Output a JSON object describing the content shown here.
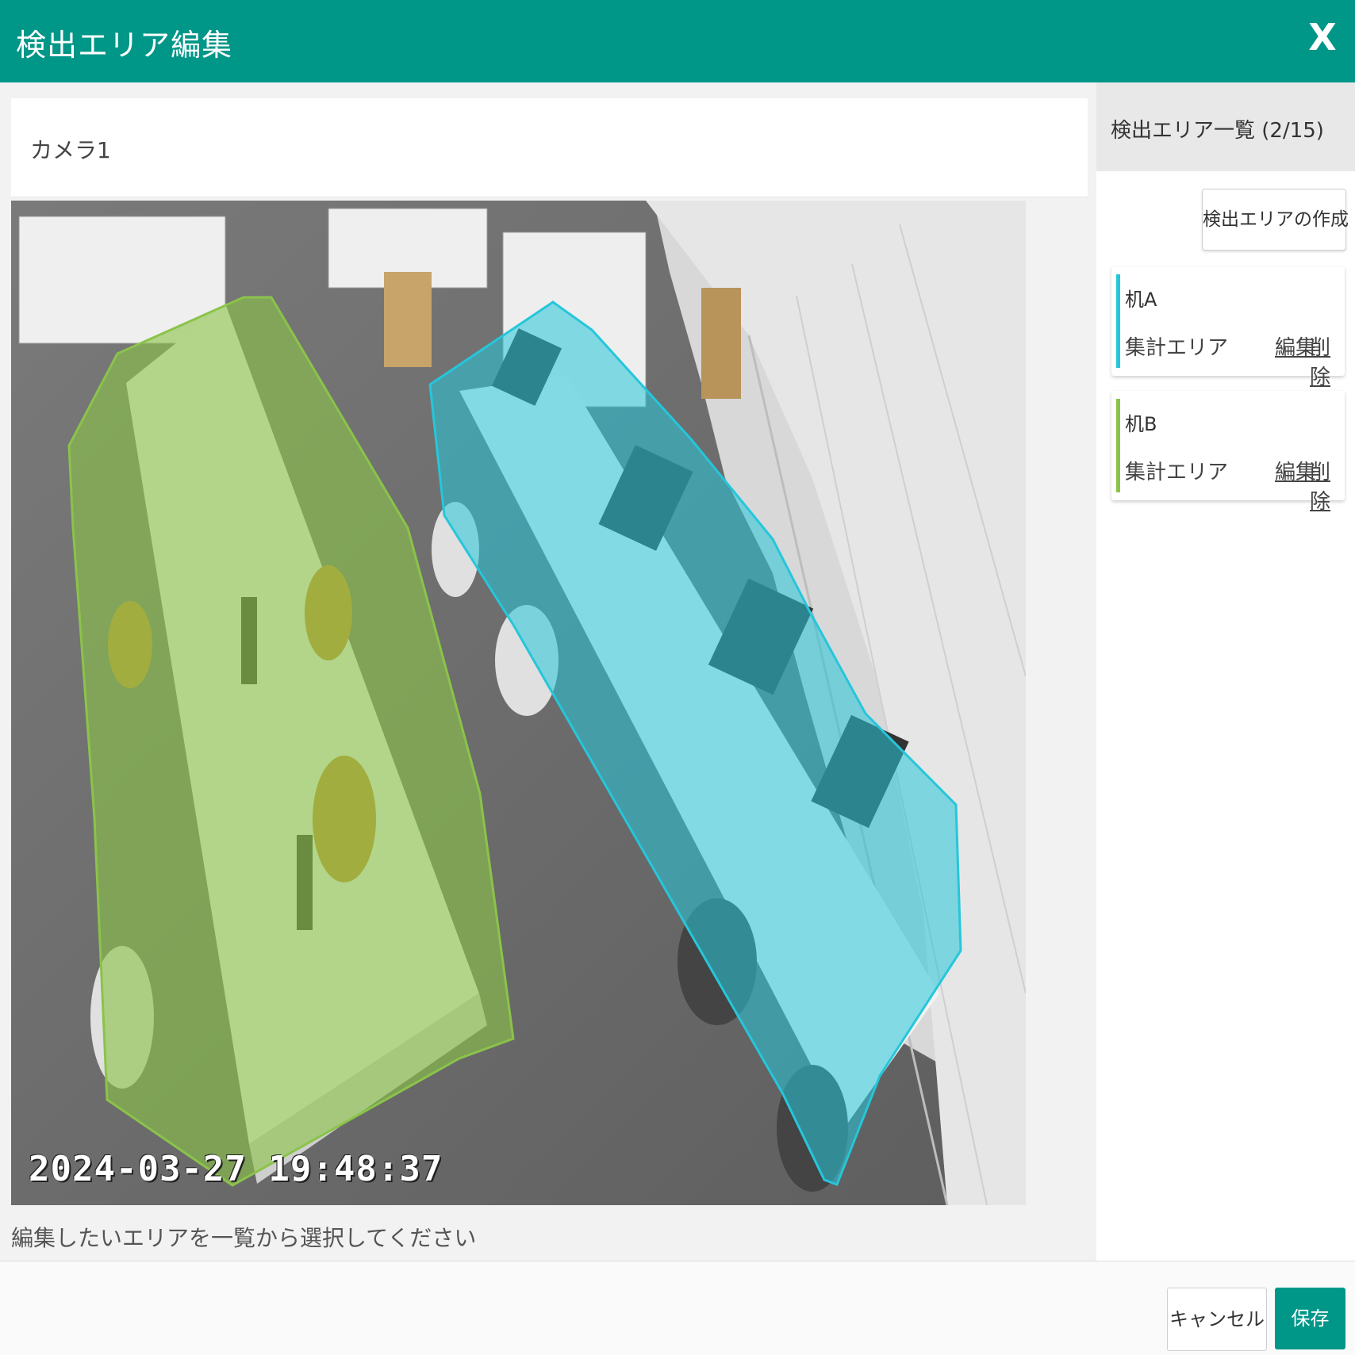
{
  "dialog": {
    "title": "検出エリア編集",
    "close_label": "X"
  },
  "camera": {
    "name": "カメラ1",
    "timestamp": "2024-03-27 19:48:37",
    "hint": "編集したいエリアを一覧から選択してください"
  },
  "sidebar": {
    "header": "検出エリア一覧 (2/15)",
    "create_label": "検出エリアの作成",
    "areas": [
      {
        "name": "机A",
        "type": "集計エリア",
        "edit_label": "編集",
        "delete_label": "削除",
        "color": "#26c6da"
      },
      {
        "name": "机B",
        "type": "集計エリア",
        "edit_label": "編集",
        "delete_label": "削除",
        "color": "#8bc34a"
      }
    ]
  },
  "footer": {
    "cancel_label": "キャンセル",
    "save_label": "保存"
  },
  "colors": {
    "header": "#009688",
    "area_a": "#26c6da",
    "area_b": "#8bc34a"
  }
}
